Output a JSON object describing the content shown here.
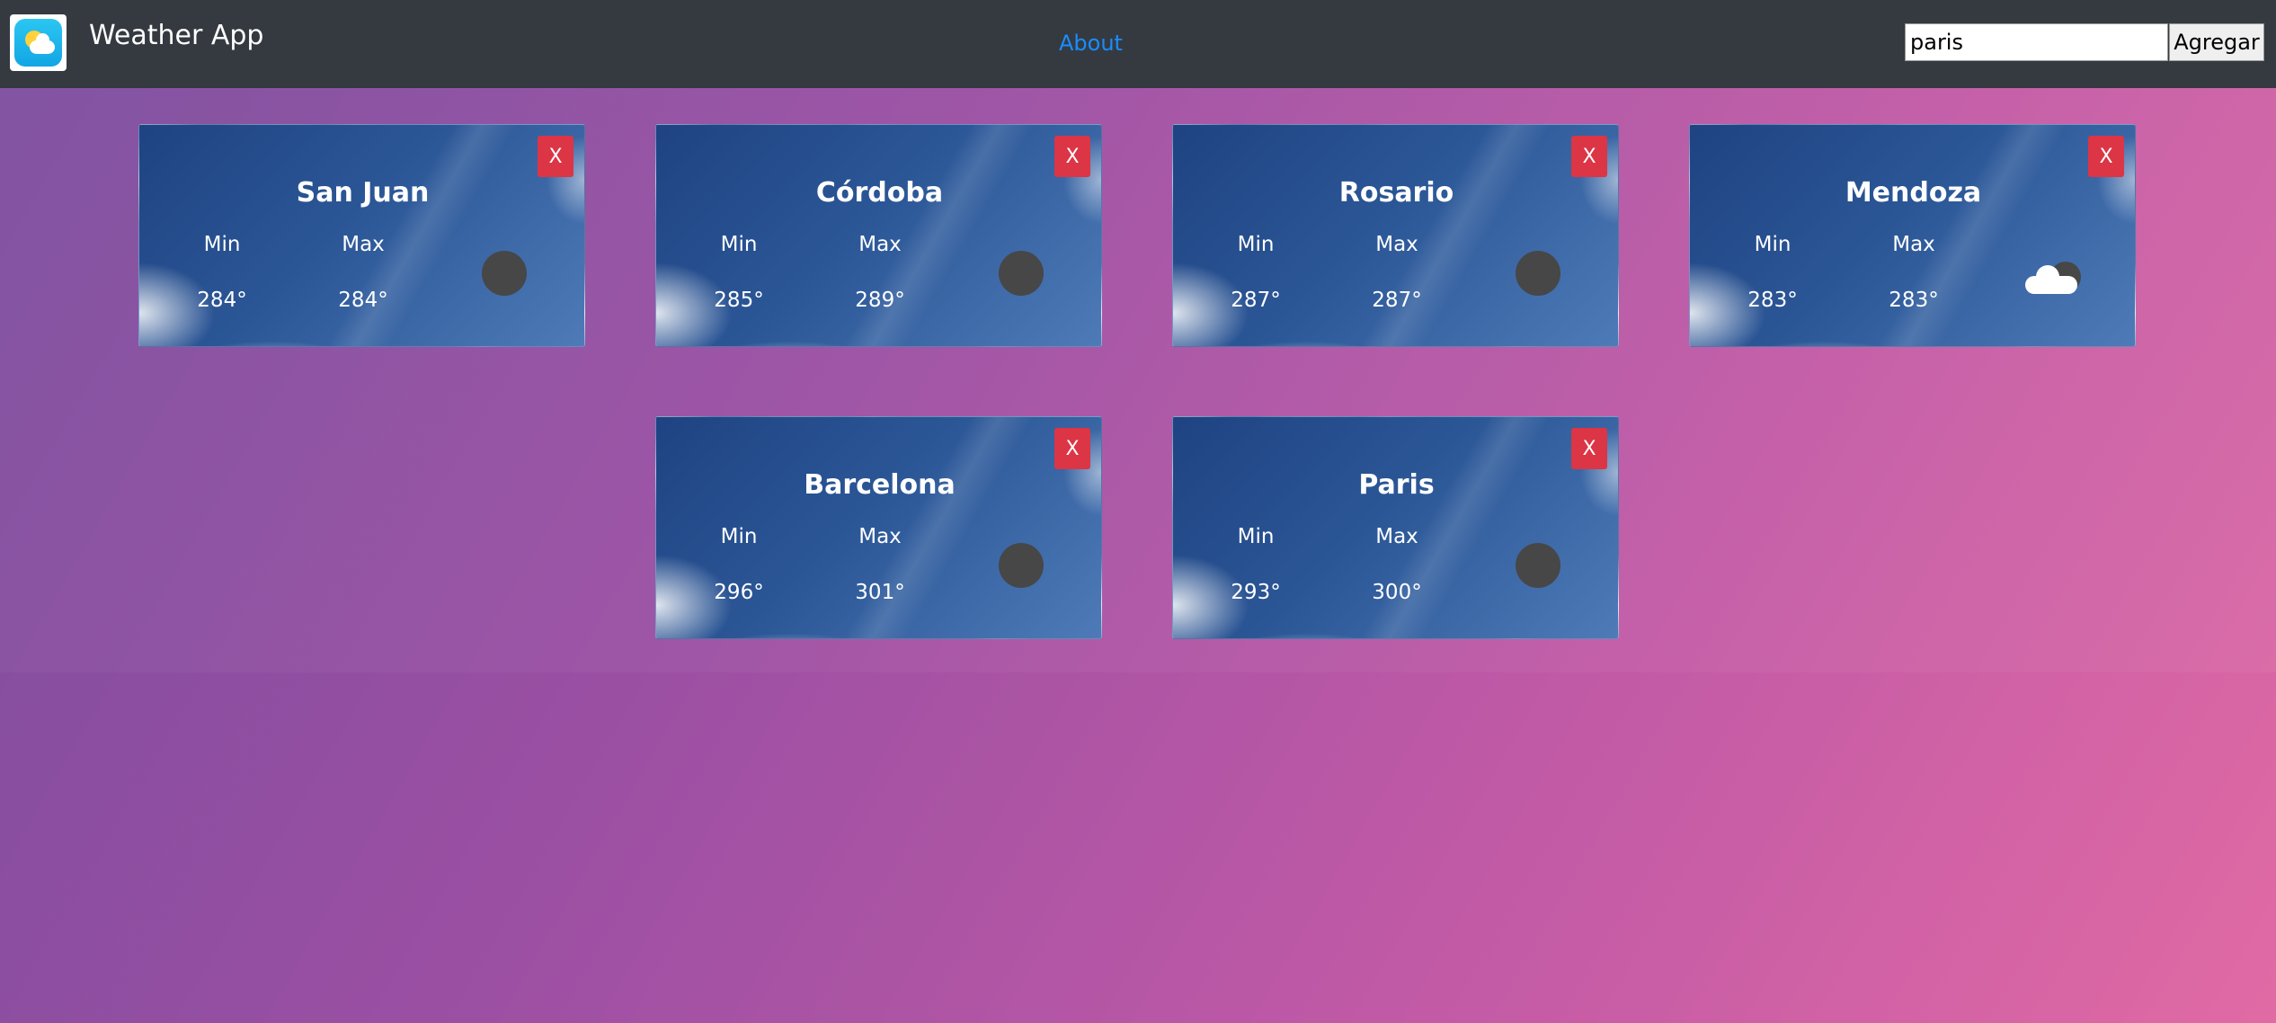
{
  "header": {
    "title": "Weather App",
    "about_label": "About",
    "search_value": "paris",
    "add_label": "Agregar"
  },
  "labels": {
    "min": "Min",
    "max": "Max",
    "close": "X"
  },
  "cards": [
    {
      "city": "San Juan",
      "min": "284°",
      "max": "284°",
      "icon": "dark-circle-icon"
    },
    {
      "city": "Córdoba",
      "min": "285°",
      "max": "289°",
      "icon": "dark-circle-icon"
    },
    {
      "city": "Rosario",
      "min": "287°",
      "max": "287°",
      "icon": "dark-circle-icon"
    },
    {
      "city": "Mendoza",
      "min": "283°",
      "max": "283°",
      "icon": "cloud-moon-icon"
    },
    {
      "city": "Barcelona",
      "min": "296°",
      "max": "301°",
      "icon": "dark-circle-icon"
    },
    {
      "city": "Paris",
      "min": "293°",
      "max": "300°",
      "icon": "dark-circle-icon"
    }
  ],
  "colors": {
    "navbar": "#343a40",
    "link": "#1a8cff",
    "close_button": "#dc3545"
  }
}
